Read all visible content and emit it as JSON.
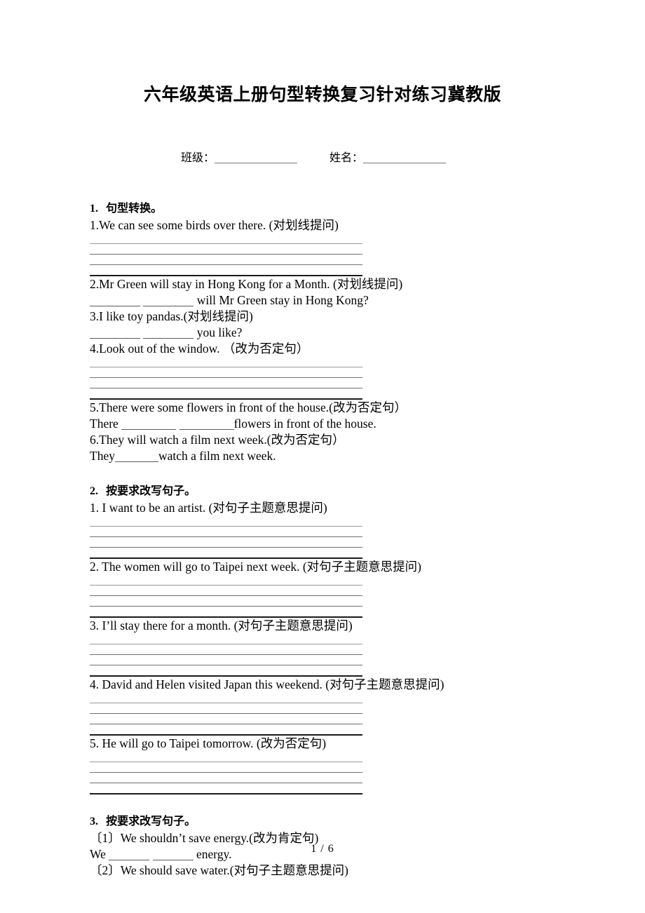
{
  "document": {
    "title": "六年级英语上册句型转换复习针对练习冀教版",
    "info_row": {
      "class_label": "班级：",
      "name_label": "姓名："
    },
    "footer": "1 / 6"
  },
  "sections": [
    {
      "heading_number": "1.",
      "heading_text": "句型转换。",
      "items": [
        {
          "prompt": "1.We can see some birds over there. (对划线提问)",
          "answer_type": "rules",
          "rule_count": 4
        },
        {
          "prompt": "2.Mr Green will stay in Hong Kong for a Month. (对划线提问)",
          "answer_type": "inline",
          "answer_prefix": "",
          "answer_blanks": 2,
          "answer_suffix": "will Mr Green stay in Hong Kong?"
        },
        {
          "prompt": "3.I like toy pandas.(对划线提问)",
          "answer_type": "inline",
          "answer_prefix": "",
          "answer_blanks": 2,
          "answer_suffix": "you like?"
        },
        {
          "prompt": "4.Look out of the window. （改为否定句）",
          "answer_type": "rules",
          "rule_count": 4
        },
        {
          "prompt": "5.There were some flowers in front of the house.(改为否定句）",
          "answer_type": "inline",
          "answer_prefix": "There",
          "answer_blanks": 2,
          "answer_suffix": "flowers in front of the house."
        },
        {
          "prompt": "6.They will watch a film next week.(改为否定句）",
          "answer_type": "inline",
          "answer_prefix": "They",
          "answer_blanks": 1,
          "answer_suffix": "watch a film next week."
        }
      ]
    },
    {
      "heading_number": "2.",
      "heading_text": "按要求改写句子。",
      "items": [
        {
          "prompt": "1. I want to be an artist.  (对句子主题意思提问)",
          "answer_type": "rules",
          "rule_count": 4
        },
        {
          "prompt": "2. The women will go to Taipei next week. (对句子主题意思提问)",
          "answer_type": "rules",
          "rule_count": 4
        },
        {
          "prompt": "3. I’ll stay there for a month. (对句子主题意思提问)",
          "answer_type": "rules",
          "rule_count": 4
        },
        {
          "prompt": "4. David and Helen visited Japan this weekend. (对句子主题意思提问)",
          "answer_type": "rules",
          "rule_count": 4
        },
        {
          "prompt": "5. He will go to Taipei tomorrow. (改为否定句)",
          "answer_type": "rules",
          "rule_count": 4
        }
      ]
    },
    {
      "heading_number": "3.",
      "heading_text": "按要求改写句子。",
      "items": [
        {
          "prompt": "〔1〕We shouldn’t save energy.(改为肯定句)",
          "answer_type": "inline",
          "answer_prefix": "We",
          "answer_blanks": 2,
          "answer_suffix": "energy."
        },
        {
          "prompt": "〔2〕We should save water.(对句子主题意思提问)",
          "answer_type": "none"
        }
      ]
    }
  ]
}
